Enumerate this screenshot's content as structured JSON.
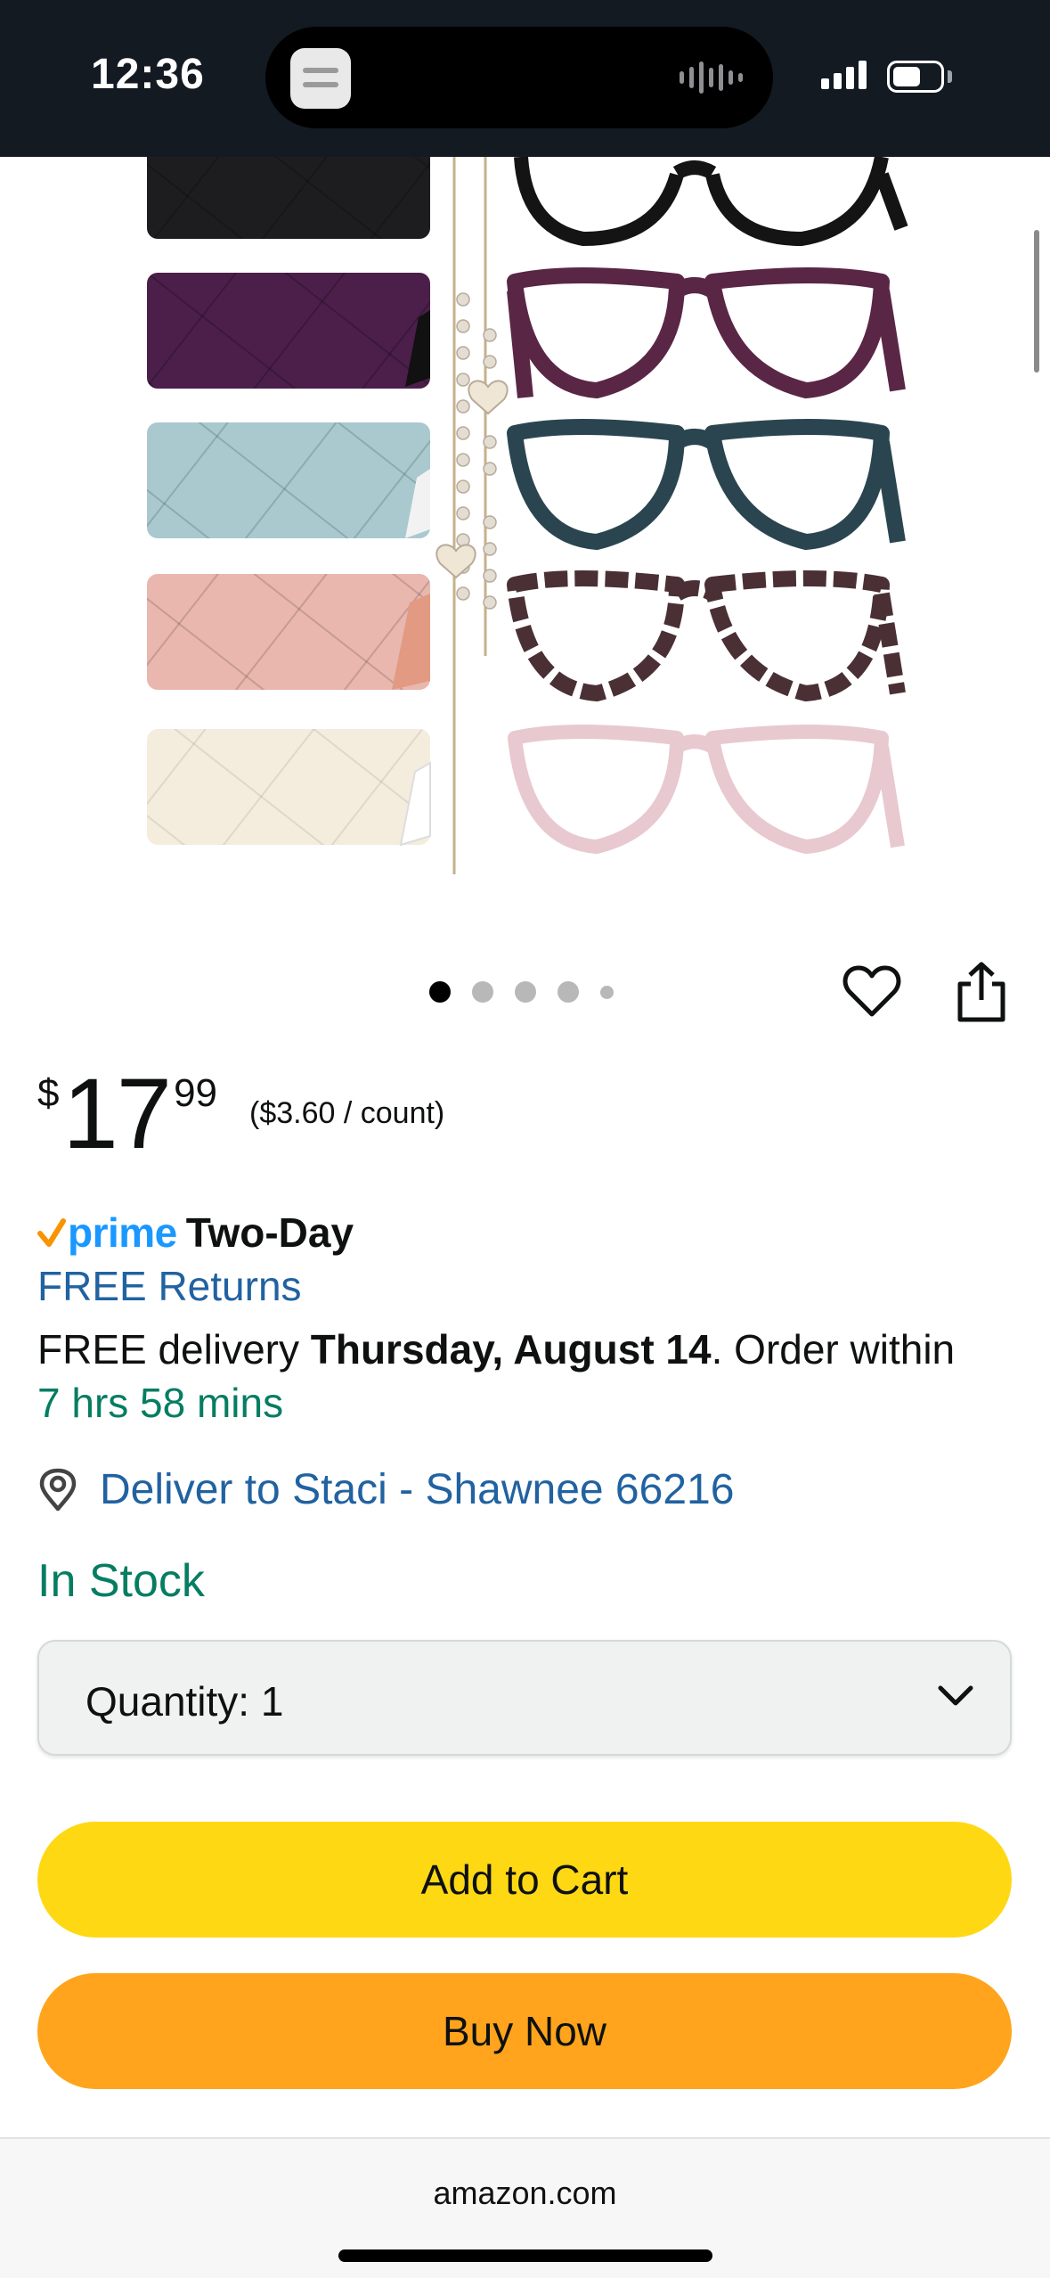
{
  "status_bar": {
    "time": "12:36"
  },
  "gallery": {
    "dot_count": 5,
    "active_index": 0
  },
  "price": {
    "symbol": "$",
    "whole": "17",
    "fraction": "99",
    "unit_price": "($3.60 / count)"
  },
  "delivery": {
    "prime_word": "prime",
    "prime_speed": "Two-Day",
    "free_returns": "FREE Returns",
    "line_prefix": "FREE delivery ",
    "date": "Thursday, August 14",
    "line_suffix": ". Order within",
    "countdown": "7 hrs 58 mins",
    "deliver_to": "Deliver to Staci - Shawnee 66216"
  },
  "stock": "In Stock",
  "quantity": {
    "label": "Quantity:",
    "value": "1"
  },
  "buttons": {
    "add_to_cart": "Add to Cart",
    "buy_now": "Buy Now"
  },
  "browser": {
    "url": "amazon.com"
  },
  "product": {
    "case_colors": [
      "#1d1d1f",
      "#4b1f4a",
      "#a9c9cf",
      "#e9b7ae",
      "#f4eddd"
    ],
    "frame_colors": [
      "#141414",
      "#5a2646",
      "#2b4550",
      "#4a3034",
      "#e8c9cf"
    ]
  },
  "colors": {
    "status_bar_bg": "#131a22",
    "link": "#2162a1",
    "in_stock": "#067d62",
    "prime_blue": "#1a98ff",
    "add_to_cart_bg": "#ffd814",
    "buy_now_bg": "#ffa41c"
  },
  "icons": [
    "wishlist-heart",
    "share",
    "location-pin",
    "chevron-down",
    "prime-check"
  ]
}
